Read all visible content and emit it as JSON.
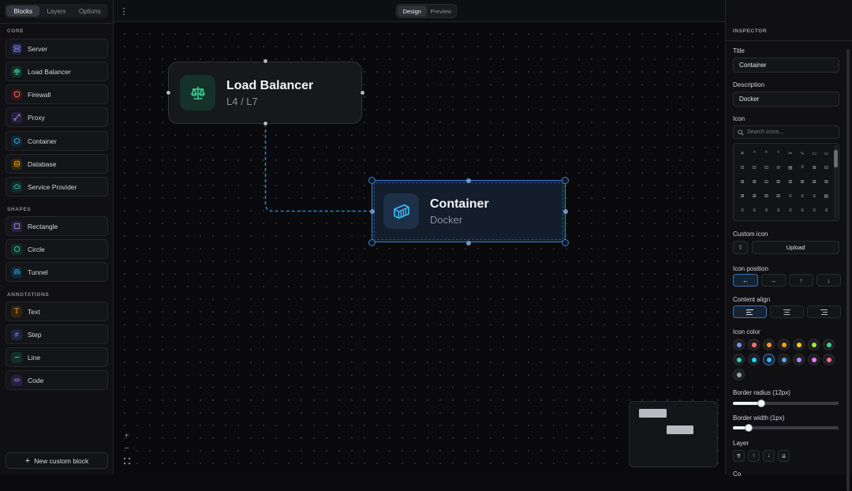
{
  "left": {
    "tabs": [
      "Blocks",
      "Layers",
      "Options"
    ],
    "sections": {
      "core": "CORE",
      "shapes": "SHAPES",
      "annotations": "ANNOTATIONS"
    },
    "core_items": [
      "Server",
      "Load Balancer",
      "Firewall",
      "Proxy",
      "Container",
      "Database",
      "Service Provider"
    ],
    "shape_items": [
      "Rectangle",
      "Circle",
      "Tunnel"
    ],
    "annotation_items": [
      "Text",
      "Step",
      "Line",
      "Code"
    ],
    "new_block": "New custom block"
  },
  "topbar": {
    "modes": [
      "Design",
      "Preview"
    ],
    "active_mode": "Design"
  },
  "canvas": {
    "nodes": [
      {
        "title": "Load Balancer",
        "subtitle": "L4 / L7",
        "icon": "scale-icon",
        "color": "#34d399"
      },
      {
        "title": "Container",
        "subtitle": "Docker",
        "icon": "container-icon",
        "color": "#38bdf8"
      }
    ],
    "zoom": {
      "in": "+",
      "out": "−"
    }
  },
  "inspector": {
    "header": "INSPECTOR",
    "title_label": "Title",
    "title_value": "Container",
    "description_label": "Description",
    "description_value": "Docker",
    "icon_label": "Icon",
    "icon_search_placeholder": "Search icons...",
    "custom_icon_label": "Custom icon",
    "upload_label": "Upload",
    "icon_position_label": "Icon position",
    "icon_positions": [
      "←",
      "→",
      "↑",
      "↓"
    ],
    "content_align_label": "Content align",
    "icon_color_label": "Icon color",
    "icon_colors": [
      "#818cf8",
      "#f87171",
      "#fb923c",
      "#f59e0b",
      "#facc15",
      "#a3e635",
      "#34d399",
      "#2dd4bf",
      "#22d3ee",
      "#38bdf8",
      "#60a5fa",
      "#a78bfa",
      "#e879f9",
      "#fb7185",
      "#9ca3af"
    ],
    "selected_color": "#38bdf8",
    "border_radius_label": "Border radius (12px)",
    "border_radius_value": 0.27,
    "border_width_label": "Border width (1px)",
    "border_width_value": 0.15,
    "layer_label": "Layer",
    "layer_buttons": [
      "⇈",
      "↑",
      "↓",
      "⇊"
    ],
    "last_label": "Co"
  }
}
